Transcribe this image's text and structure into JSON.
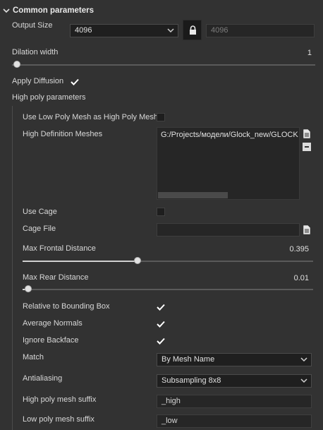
{
  "section": {
    "title": "Common parameters",
    "output_size": {
      "label": "Output Size",
      "value": "4096",
      "linked_value": "4096"
    },
    "dilation": {
      "label": "Dilation width",
      "value": "1",
      "fraction": 0.02
    },
    "apply_diffusion": {
      "label": "Apply Diffusion",
      "checked": true
    },
    "high_poly_params_label": "High poly parameters"
  },
  "high_poly": {
    "use_low_poly": {
      "label": "Use Low Poly Mesh as High Poly Mesh",
      "checked": false
    },
    "hd_meshes": {
      "label": "High Definition Meshes",
      "path": "G:/Projects/модели/Glock_new/GLOCK"
    },
    "use_cage": {
      "label": "Use Cage",
      "checked": false
    },
    "cage_file": {
      "label": "Cage File",
      "value": ""
    },
    "max_frontal": {
      "label": "Max Frontal Distance",
      "value": "0.395",
      "fraction": 0.395
    },
    "max_rear": {
      "label": "Max Rear Distance",
      "value": "0.01",
      "fraction": 0.01
    },
    "relative_bbox": {
      "label": "Relative to Bounding Box",
      "checked": true
    },
    "average_normals": {
      "label": "Average Normals",
      "checked": true
    },
    "ignore_backface": {
      "label": "Ignore Backface",
      "checked": true
    },
    "match": {
      "label": "Match",
      "value": "By Mesh Name"
    },
    "antialiasing": {
      "label": "Antialiasing",
      "value": "Subsampling 8x8"
    },
    "high_suffix": {
      "label": "High poly mesh suffix",
      "value": "_high"
    },
    "low_suffix": {
      "label": "Low poly mesh suffix",
      "value": "_low"
    }
  },
  "icons": {
    "header_chevron": "chevron-down-icon",
    "lock": "lock-icon",
    "file": "file-icon",
    "minus": "minus-icon",
    "check": "check-icon"
  },
  "colors": {
    "panel_bg": "#323232",
    "field_bg": "#1f1f1f",
    "text": "#d8d8d8",
    "check": "#ffffff"
  }
}
